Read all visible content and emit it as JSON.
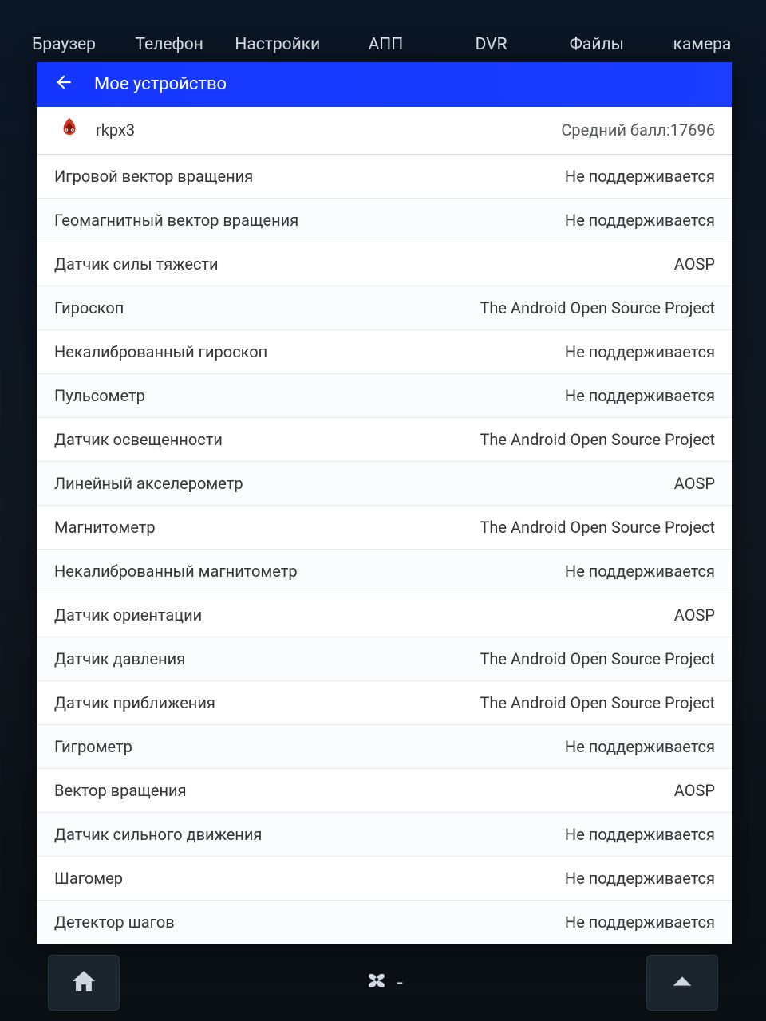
{
  "launcher": {
    "items": [
      {
        "label": "Браузер"
      },
      {
        "label": "Телефон"
      },
      {
        "label": "Настройки"
      },
      {
        "label": "АПП"
      },
      {
        "label": "DVR"
      },
      {
        "label": "Файлы"
      },
      {
        "label": "камера"
      }
    ]
  },
  "header": {
    "title": "Мое устройство"
  },
  "device": {
    "name": "rkpx3",
    "score_label": "Средний балл:17696"
  },
  "sensors": [
    {
      "label": "Игровой вектор вращения",
      "value": "Не поддерживается"
    },
    {
      "label": "Геомагнитный вектор вращения",
      "value": "Не поддерживается"
    },
    {
      "label": "Датчик силы тяжести",
      "value": "AOSP"
    },
    {
      "label": "Гироскоп",
      "value": "The Android Open Source Project"
    },
    {
      "label": "Некалиброванный гироскоп",
      "value": "Не поддерживается"
    },
    {
      "label": "Пульсометр",
      "value": "Не поддерживается"
    },
    {
      "label": "Датчик освещенности",
      "value": "The Android Open Source Project"
    },
    {
      "label": "Линейный акселерометр",
      "value": "AOSP"
    },
    {
      "label": "Магнитометр",
      "value": "The Android Open Source Project"
    },
    {
      "label": "Некалиброванный магнитометр",
      "value": "Не поддерживается"
    },
    {
      "label": "Датчик ориентации",
      "value": "AOSP"
    },
    {
      "label": "Датчик давления",
      "value": "The Android Open Source Project"
    },
    {
      "label": "Датчик приближения",
      "value": "The Android Open Source Project"
    },
    {
      "label": "Гигрометр",
      "value": "Не поддерживается"
    },
    {
      "label": "Вектор вращения",
      "value": "AOSP"
    },
    {
      "label": "Датчик сильного движения",
      "value": "Не поддерживается"
    },
    {
      "label": "Шагомер",
      "value": "Не поддерживается"
    },
    {
      "label": "Детектор шагов",
      "value": "Не поддерживается"
    }
  ],
  "bottombar": {
    "fan_text": "-"
  }
}
